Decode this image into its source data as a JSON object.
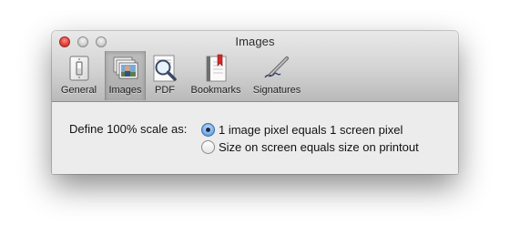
{
  "window": {
    "title": "Images"
  },
  "toolbar": {
    "tabs": [
      {
        "label": "General",
        "icon": "light-switch-icon",
        "selected": false
      },
      {
        "label": "Images",
        "icon": "photos-icon",
        "selected": true
      },
      {
        "label": "PDF",
        "icon": "pdf-magnifier-icon",
        "selected": false
      },
      {
        "label": "Bookmarks",
        "icon": "bookmark-book-icon",
        "selected": false
      },
      {
        "label": "Signatures",
        "icon": "pen-signature-icon",
        "selected": false
      }
    ]
  },
  "scale": {
    "label": "Define 100% scale as:",
    "options": [
      {
        "label": "1 image pixel equals 1 screen pixel",
        "checked": true
      },
      {
        "label": "Size on screen equals size on printout",
        "checked": false
      }
    ]
  },
  "colors": {
    "close_button": "#e0443e",
    "radio_selected": "#5d98dc",
    "toolbar_top": "#e9e9e9",
    "toolbar_bottom": "#b9b9b9",
    "content_bg": "#ececec"
  }
}
